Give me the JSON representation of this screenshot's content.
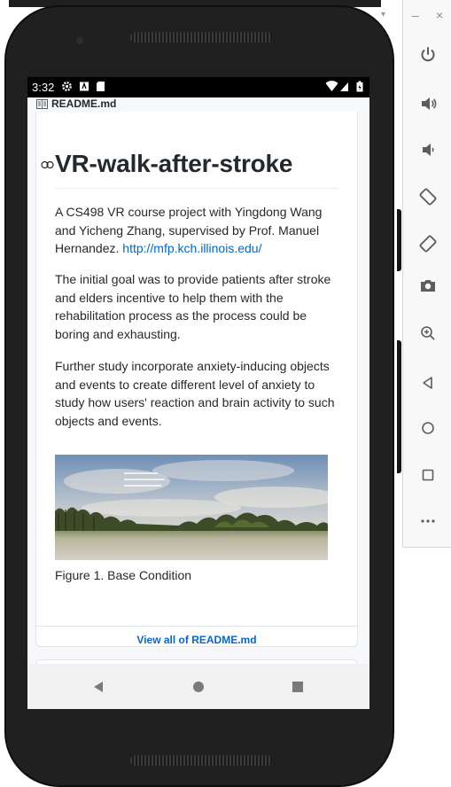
{
  "status_bar": {
    "time": "3:32",
    "icons": [
      "settings-gear-icon",
      "notification-a-icon",
      "sd-card-icon",
      "wifi-icon",
      "cell-signal-icon",
      "battery-icon"
    ]
  },
  "readme": {
    "filename": "README.md",
    "title": "VR-walk-after-stroke",
    "paragraph1_text": "A CS498 VR course project with Yingdong Wang and Yicheng Zhang, supervised by Prof. Manuel Hernandez.",
    "paragraph1_link": "http://mfp.kch.illinois.edu/",
    "paragraph2": "The initial goal was to provide patients after stroke and elders incentive to help them with the rehabilitation process as the process could be boring and exhausting.",
    "paragraph3": "Further study incorporate anxiety-inducing objects and events to create different level of anxiety to study how users' reaction and brain activity to such objects and events.",
    "figure_caption": "Figure 1. Base Condition",
    "view_all": "View all of README.md"
  },
  "navigation": [
    "back",
    "home",
    "recents"
  ],
  "emulator_toolbar": [
    "minimize",
    "close",
    "power",
    "volume-up",
    "volume-down",
    "rotate-left",
    "rotate-right",
    "screenshot",
    "zoom",
    "back",
    "home",
    "overview",
    "more"
  ],
  "colors": {
    "link": "#0366d6",
    "text": "#24292e",
    "status_bar": "#000000",
    "nav_bar": "#f1f1f1",
    "phone_body": "#202020"
  }
}
